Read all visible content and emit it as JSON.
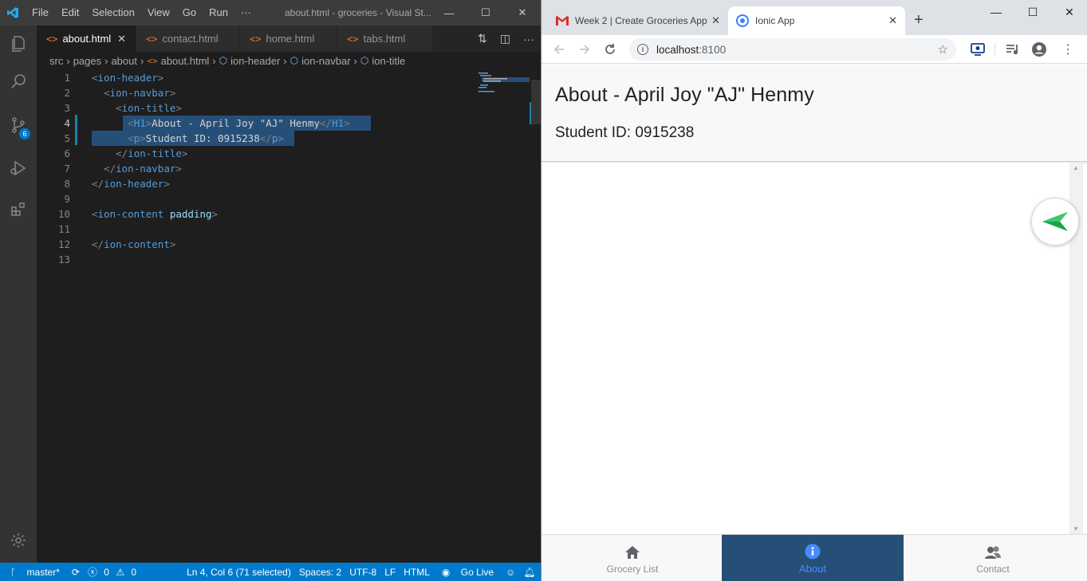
{
  "vscode": {
    "menu": [
      "File",
      "Edit",
      "Selection",
      "View",
      "Go",
      "Run",
      "···"
    ],
    "window_title": "about.html - groceries - Visual St...",
    "tabs": [
      {
        "label": "about.html",
        "active": true
      },
      {
        "label": "contact.html",
        "active": false
      },
      {
        "label": "home.html",
        "active": false
      },
      {
        "label": "tabs.html",
        "active": false
      }
    ],
    "breadcrumb": [
      "src",
      "pages",
      "about",
      "about.html",
      "ion-header",
      "ion-navbar",
      "ion-title"
    ],
    "scm_badge": "6",
    "code_lines": [
      {
        "num": "1",
        "indent": "",
        "open": "ion-header"
      },
      {
        "num": "2",
        "indent": "  ",
        "open": "ion-navbar"
      },
      {
        "num": "3",
        "indent": "    ",
        "open": "ion-title"
      },
      {
        "num": "4",
        "indent": "      ",
        "inner_tag": "H1",
        "inner_text": "About - April Joy \"AJ\" Henmy"
      },
      {
        "num": "5",
        "indent": "      ",
        "inner_tag": "p",
        "inner_text": "Student ID: 0915238"
      },
      {
        "num": "6",
        "indent": "    ",
        "close": "ion-title"
      },
      {
        "num": "7",
        "indent": "  ",
        "close": "ion-navbar"
      },
      {
        "num": "8",
        "indent": "",
        "close": "ion-header"
      },
      {
        "num": "9"
      },
      {
        "num": "10",
        "indent": "",
        "open": "ion-content",
        "attr": "padding"
      },
      {
        "num": "11"
      },
      {
        "num": "12",
        "indent": "",
        "close": "ion-content"
      },
      {
        "num": "13"
      }
    ],
    "status": {
      "branch": "master*",
      "errors": "0",
      "warnings": "0",
      "position": "Ln 4, Col 6 (71 selected)",
      "spaces": "Spaces: 2",
      "encoding": "UTF-8",
      "eol": "LF",
      "language": "HTML",
      "golive": "Go Live"
    }
  },
  "chrome": {
    "tabs": [
      {
        "label": "Week 2 | Create Groceries App",
        "active": false
      },
      {
        "label": "Ionic App",
        "active": true
      }
    ],
    "url_host": "localhost",
    "url_port": ":8100",
    "page": {
      "title": "About - April Joy \"AJ\" Henmy",
      "subtitle": "Student ID: 0915238",
      "tabbar": [
        {
          "label": "Grocery List",
          "icon": "home-icon",
          "selected": false
        },
        {
          "label": "About",
          "icon": "info-icon",
          "selected": true
        },
        {
          "label": "Contact",
          "icon": "contacts-icon",
          "selected": false
        }
      ]
    }
  },
  "colors": {
    "vs_accent": "#007acc",
    "ionic_primary": "#488aff",
    "html_tag": "#569cd6"
  }
}
